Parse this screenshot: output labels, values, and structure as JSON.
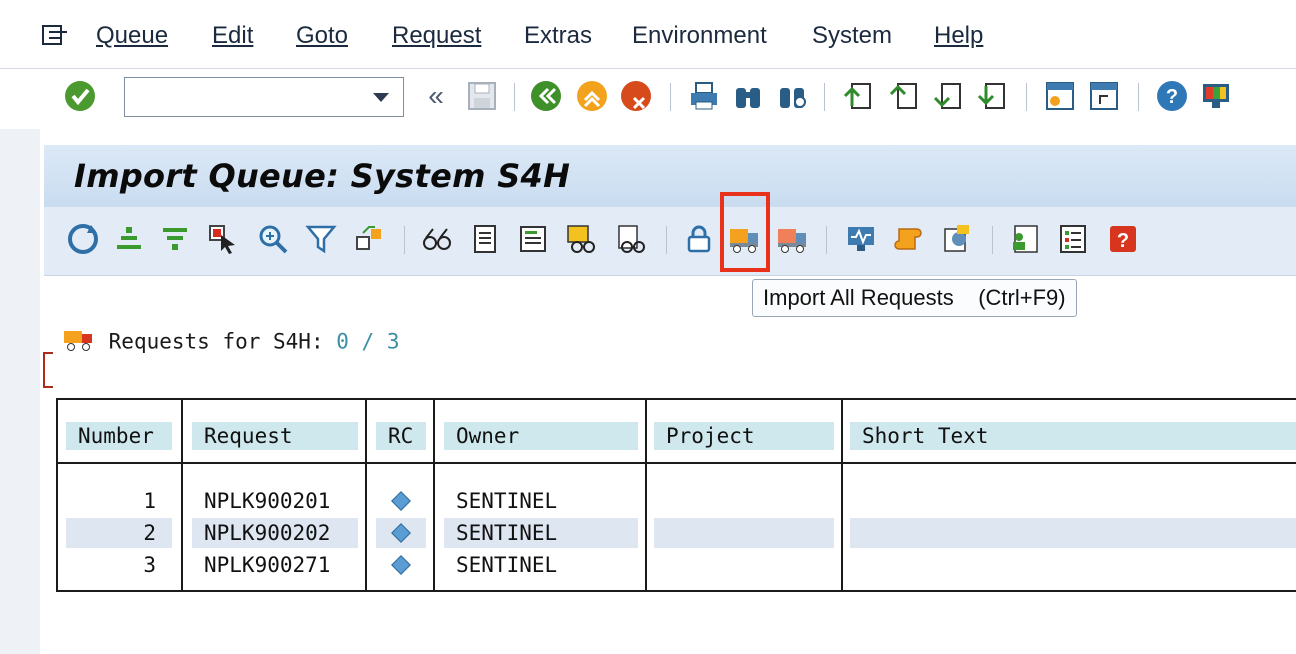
{
  "menubar": {
    "items": [
      {
        "label": "Queue"
      },
      {
        "label": "Edit"
      },
      {
        "label": "Goto"
      },
      {
        "label": "Request"
      },
      {
        "label": "Extras"
      },
      {
        "label": "Environment"
      },
      {
        "label": "System"
      },
      {
        "label": "Help"
      }
    ]
  },
  "toolbar": {
    "command_value": "",
    "back_glyph": "«"
  },
  "page": {
    "title": "Import Queue: System S4H"
  },
  "tooltip": {
    "text": "Import All Requests    (Ctrl+F9)"
  },
  "requests": {
    "label": "Requests for S4H:",
    "count": "0 / 3"
  },
  "table": {
    "headers": [
      "Number",
      "Request",
      "RC",
      "Owner",
      "Project",
      "Short Text"
    ],
    "rows": [
      {
        "number": "1",
        "request": "NPLK900201",
        "rc": "diamond",
        "owner": "SENTINEL",
        "project": "",
        "short_text": ""
      },
      {
        "number": "2",
        "request": "NPLK900202",
        "rc": "diamond",
        "owner": "SENTINEL",
        "project": "",
        "short_text": ""
      },
      {
        "number": "3",
        "request": "NPLK900271",
        "rc": "diamond",
        "owner": "SENTINEL",
        "project": "",
        "short_text": ""
      }
    ]
  },
  "colors": {
    "highlight": "#e8321c",
    "header_cell": "#cfe8ee",
    "title_bar": "#c9dcf0",
    "alt_row": "#dde6f1"
  }
}
